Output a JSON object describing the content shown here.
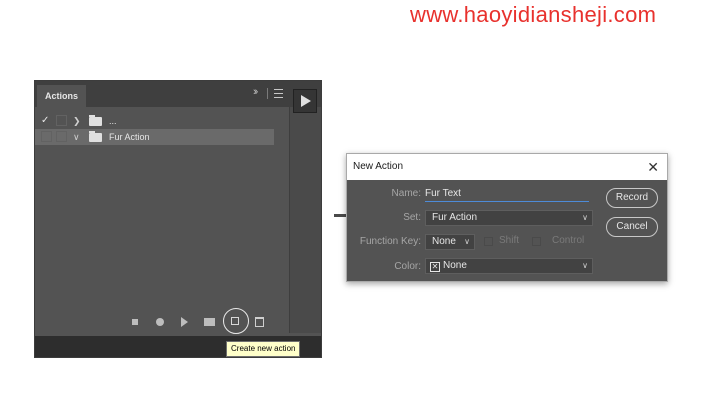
{
  "watermark": "www.haoyidiansheji.com",
  "actions_panel": {
    "tab_label": "Actions",
    "collapse_icon": "double-chevron-right-icon",
    "menu_icon": "panel-menu-icon",
    "rows": [
      {
        "checked": true,
        "label": "...",
        "expanded": false
      },
      {
        "checked": false,
        "label": "Fur Action",
        "expanded": true,
        "selected": true
      }
    ],
    "footer_icons": [
      "stop-icon",
      "record-icon",
      "play-icon",
      "new-set-icon",
      "new-action-icon",
      "trash-icon"
    ],
    "tooltip": "Create new action"
  },
  "dialog": {
    "title": "New Action",
    "name_label": "Name:",
    "name_value": "Fur Text",
    "set_label": "Set:",
    "set_value": "Fur Action",
    "function_key_label": "Function Key:",
    "function_key_value": "None",
    "shift_label": "Shift",
    "control_label": "Control",
    "color_label": "Color:",
    "color_value": "None",
    "record_button": "Record",
    "cancel_button": "Cancel"
  },
  "colors": {
    "panel_bg": "#535353",
    "accent_underline": "#4d8bd8",
    "tooltip_bg": "#ffffca",
    "watermark": "#e8312d"
  }
}
